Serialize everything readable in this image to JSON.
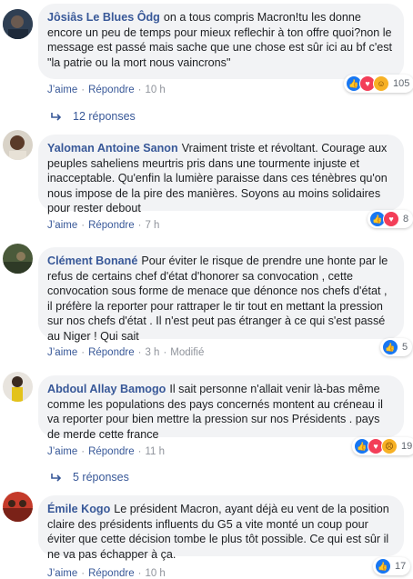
{
  "actions": {
    "like": "J’aime",
    "reply": "Répondre",
    "sep": "·",
    "modified": "Modifié"
  },
  "comments": [
    {
      "author": "Jôsiâs Le Blues Ôdg",
      "text": "on a tous compris Macron!tu les donne encore un peu de temps pour mieux reflechir à ton offre quoi?non le message est passé mais sache que une chose est sûr ici au bf c'est \"la patrie ou la mort nous vaincrons\"",
      "time": "10 h",
      "reactions": [
        "like-icon",
        "love-icon",
        "haha-icon"
      ],
      "count": "105"
    },
    {
      "author": "Yaloman Antoine Sanon",
      "text": "Vraiment triste et révoltant. Courage aux peuples saheliens meurtris pris dans une tourmente injuste et inacceptable. Qu'enfin la lumière paraisse dans ces ténèbres qu'on nous impose de la pire des manières. Soyons au moins solidaires pour rester debout",
      "time": "7 h",
      "reactions": [
        "like-icon",
        "love-icon"
      ],
      "count": "8"
    },
    {
      "author": "Clément Bonané",
      "text": "Pour éviter le risque de prendre une honte par le refus de certains chef d'état d'honorer sa convocation , cette convocation sous forme de menace que dénonce nos chefs d'état , il préfère la reporter pour rattraper le tir tout en mettant la pression sur nos chefs d'état . Il n'est peut pas étranger à ce qui s'est passé au Niger ! Qui sait",
      "time": "3 h",
      "modified": true,
      "reactions": [
        "like-icon"
      ],
      "count": "5"
    },
    {
      "author": "Abdoul Allay Bamogo",
      "text": "Il sait personne n'allait venir là-bas même comme les populations des pays concernés montent au créneau il va reporter pour bien mettre la pression sur nos Présidents . pays de merde cette france",
      "time": "11 h",
      "reactions": [
        "like-icon",
        "love-icon",
        "sad-icon"
      ],
      "count": "19"
    },
    {
      "author": "Émile Kogo",
      "text": "Le président Macron, ayant déjà eu vent de la position claire des présidents influents du G5 a vite monté un coup pour éviter que cette décision tombe le plus tôt possible. Ce qui est sûr il ne va pas échapper à ça.",
      "time": "10 h",
      "reactions": [
        "like-icon"
      ],
      "count": "17"
    }
  ],
  "replies": [
    {
      "label": "12 réponses"
    },
    {
      "label": "5 réponses"
    }
  ],
  "colors": {
    "link": "#385898",
    "bubble": "#f2f3f5",
    "like": "#1877f2",
    "love": "#f33e58",
    "haha": "#f7b125"
  }
}
